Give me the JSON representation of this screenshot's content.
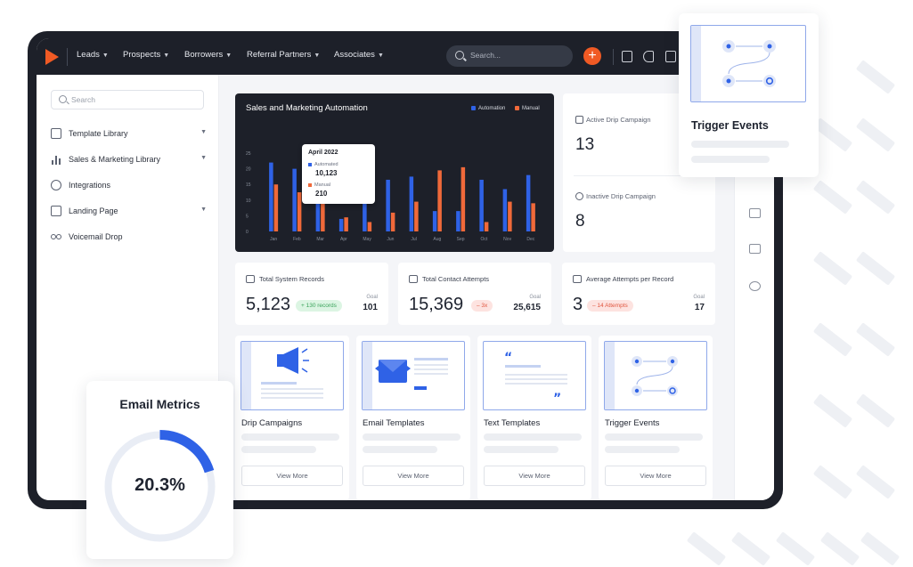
{
  "nav": {
    "items": [
      {
        "label": "Leads"
      },
      {
        "label": "Prospects"
      },
      {
        "label": "Borrowers"
      },
      {
        "label": "Referral Partners"
      },
      {
        "label": "Associates"
      }
    ],
    "search_placeholder": "Search...",
    "accent": "#f05a24"
  },
  "sidebar": {
    "search_placeholder": "Search",
    "items": [
      {
        "label": "Template Library",
        "icon": "template-icon",
        "has_chevron": true
      },
      {
        "label": "Sales & Marketing Library",
        "icon": "bar-chart-icon",
        "has_chevron": true
      },
      {
        "label": "Integrations",
        "icon": "integrations-icon",
        "has_chevron": false
      },
      {
        "label": "Landing Page",
        "icon": "landing-page-icon",
        "has_chevron": true
      },
      {
        "label": "Voicemail Drop",
        "icon": "voicemail-icon",
        "has_chevron": false
      }
    ]
  },
  "chart_data": {
    "type": "bar",
    "title": "Sales and Marketing Automation",
    "categories": [
      "Jan",
      "Feb",
      "Mar",
      "Apr",
      "May",
      "Jun",
      "Jul",
      "Aug",
      "Sep",
      "Oct",
      "Nov",
      "Dec"
    ],
    "series": [
      {
        "name": "Automation",
        "color": "#2f62e6",
        "values": [
          22,
          20,
          11,
          4,
          16.5,
          16.5,
          17.5,
          6.5,
          6.5,
          16.5,
          13.5,
          18
        ]
      },
      {
        "name": "Manual",
        "color": "#f0693a",
        "values": [
          15,
          12.5,
          14.5,
          4.5,
          3,
          6,
          9.5,
          19.5,
          20.5,
          3,
          9.5,
          9
        ]
      }
    ],
    "yticks": [
      "25",
      "20",
      "15",
      "10",
      "5",
      "0"
    ],
    "ylim": [
      0,
      27
    ],
    "grid": false,
    "legend_position": "top-right",
    "tooltip": {
      "title": "April 2022",
      "rows": [
        {
          "label": "Automated",
          "value": "10,123",
          "color": "#2f62e6"
        },
        {
          "label": "Manual",
          "value": "210",
          "color": "#f0693a"
        }
      ]
    }
  },
  "drip": {
    "active": {
      "label": "Active Drip Campaign",
      "value": "13"
    },
    "inactive": {
      "label": "Inactive Drip Campaign",
      "value": "8"
    }
  },
  "stats": [
    {
      "label": "Total System Records",
      "value": "5,123",
      "badge": "+ 130 records",
      "badge_type": "green",
      "goal_label": "Goal",
      "goal": "101"
    },
    {
      "label": "Total Contact Attempts",
      "value": "15,369",
      "badge": "– 3x",
      "badge_type": "red",
      "goal_label": "Goal",
      "goal": "25,615"
    },
    {
      "label": "Average Attempts per Record",
      "value": "3",
      "badge": "– 14 Attempts",
      "badge_type": "red",
      "goal_label": "Goal",
      "goal": "17"
    }
  ],
  "features": [
    {
      "title": "Drip Campaigns",
      "button": "View More",
      "icon": "megaphone-icon"
    },
    {
      "title": "Email Templates",
      "button": "View More",
      "icon": "envelope-icon"
    },
    {
      "title": "Text Templates",
      "button": "View More",
      "icon": "quote-icon"
    },
    {
      "title": "Trigger Events",
      "button": "View More",
      "icon": "trigger-flow-icon"
    }
  ],
  "float_trigger": {
    "title": "Trigger Events"
  },
  "email_metrics": {
    "title": "Email Metrics",
    "value": "20.3%",
    "fraction": 0.203
  }
}
